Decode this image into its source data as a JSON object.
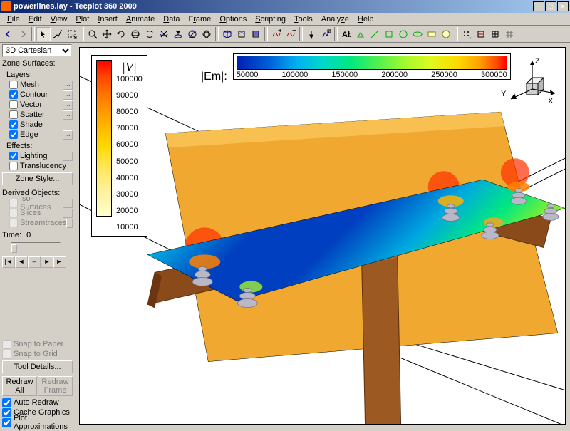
{
  "window": {
    "title": "powerlines.lay - Tecplot 360 2009",
    "min": "_",
    "max": "□",
    "close": "×"
  },
  "menus": [
    "File",
    "Edit",
    "View",
    "Plot",
    "Insert",
    "Animate",
    "Data",
    "Frame",
    "Options",
    "Scripting",
    "Tools",
    "Analyze",
    "Help"
  ],
  "sidebar": {
    "plot_type": "3D Cartesian",
    "zone_surfaces_label": "Zone Surfaces:",
    "layers_label": "Layers:",
    "layers": [
      {
        "label": "Mesh",
        "checked": false
      },
      {
        "label": "Contour",
        "checked": true
      },
      {
        "label": "Vector",
        "checked": false
      },
      {
        "label": "Scatter",
        "checked": false
      },
      {
        "label": "Shade",
        "checked": true
      },
      {
        "label": "Edge",
        "checked": true
      }
    ],
    "effects_label": "Effects:",
    "effects": [
      {
        "label": "Lighting",
        "checked": true
      },
      {
        "label": "Translucency",
        "checked": false
      }
    ],
    "zone_style_btn": "Zone Style...",
    "derived_label": "Derived Objects:",
    "derived": [
      {
        "label": "Iso-Surfaces",
        "checked": false,
        "disabled": true
      },
      {
        "label": "Slices",
        "checked": false,
        "disabled": true
      },
      {
        "label": "Streamtraces",
        "checked": false,
        "disabled": true
      }
    ],
    "time_label": "Time:",
    "time_value": "0",
    "vcr": [
      "|◄",
      "◄",
      "–",
      "►",
      "►|"
    ],
    "snap_paper": "Snap to Paper",
    "snap_grid": "Snap to Grid",
    "tool_details_btn": "Tool Details...",
    "redraw_all": "Redraw\nAll",
    "redraw_frame": "Redraw\nFrame",
    "auto_redraw": "Auto Redraw",
    "cache_graphics": "Cache Graphics",
    "plot_approx": "Plot Approximations"
  },
  "legend_v": {
    "title": "|V|",
    "values": [
      "100000",
      "90000",
      "80000",
      "70000",
      "60000",
      "50000",
      "40000",
      "30000",
      "20000",
      "10000"
    ]
  },
  "legend_h": {
    "title": "|Em|:",
    "ticks": [
      "50000",
      "100000",
      "150000",
      "200000",
      "250000",
      "300000"
    ]
  },
  "triad": {
    "x": "X",
    "y": "Y",
    "z": "Z"
  },
  "chart_data": {
    "type": "contour-3d",
    "description": "3D contour plot of electric potential |V| and field magnitude |Em| around powerline crossarm with insulators on a utility pole",
    "legend_v_variable": "|V|",
    "legend_v_range": [
      10000,
      100000
    ],
    "legend_v_ticks": [
      10000,
      20000,
      30000,
      40000,
      50000,
      60000,
      70000,
      80000,
      90000,
      100000
    ],
    "legend_h_variable": "|Em|",
    "legend_h_range": [
      50000,
      300000
    ],
    "legend_h_ticks": [
      50000,
      100000,
      150000,
      200000,
      250000,
      300000
    ],
    "axes": [
      "X",
      "Y",
      "Z"
    ]
  }
}
